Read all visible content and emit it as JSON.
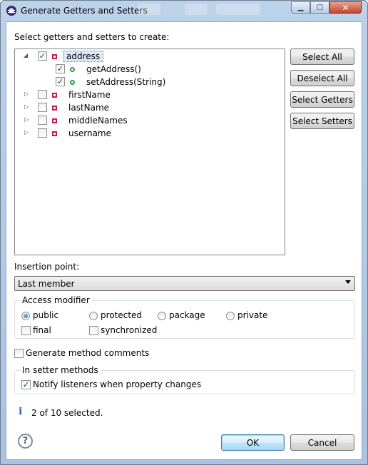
{
  "window": {
    "title": "Generate Getters and Setters",
    "minimize_glyph": "▁",
    "maximize_glyph": "□",
    "close_glyph": "✕"
  },
  "tree": {
    "heading": "Select getters and setters to create:",
    "items": [
      {
        "label": "address",
        "checked": true,
        "expanded": true,
        "kind": "field",
        "selected": true,
        "children": [
          {
            "label": "getAddress()",
            "checked": true,
            "kind": "method"
          },
          {
            "label": "setAddress(String)",
            "checked": true,
            "kind": "method"
          }
        ]
      },
      {
        "label": "firstName",
        "checked": false,
        "expanded": false,
        "kind": "field"
      },
      {
        "label": "lastName",
        "checked": false,
        "expanded": false,
        "kind": "field"
      },
      {
        "label": "middleNames",
        "checked": false,
        "expanded": false,
        "kind": "field"
      },
      {
        "label": "username",
        "checked": false,
        "expanded": false,
        "kind": "field"
      }
    ]
  },
  "side_buttons": {
    "select_all": "Select All",
    "deselect_all": "Deselect All",
    "select_getters": "Select Getters",
    "select_setters": "Select Setters"
  },
  "insertion": {
    "label": "Insertion point:",
    "value": "Last member"
  },
  "access_modifier": {
    "title": "Access modifier",
    "options": [
      "public",
      "protected",
      "package",
      "private"
    ],
    "selected": "public",
    "final_label": "final",
    "final_checked": false,
    "synchronized_label": "synchronized",
    "synchronized_checked": false
  },
  "generate_comments": {
    "label": "Generate method comments",
    "checked": false
  },
  "setter_methods": {
    "title": "In setter methods",
    "notify_label": "Notify listeners when property changes",
    "notify_checked": true
  },
  "status": {
    "text": "2 of 10 selected.",
    "icon": "info-icon"
  },
  "footer": {
    "help_glyph": "?",
    "ok": "OK",
    "cancel": "Cancel"
  },
  "colors": {
    "accent": "#3c7fb1",
    "field_icon": "#c02050",
    "method_icon": "#2f9a4a",
    "selection_bg": "#dce9f7"
  }
}
